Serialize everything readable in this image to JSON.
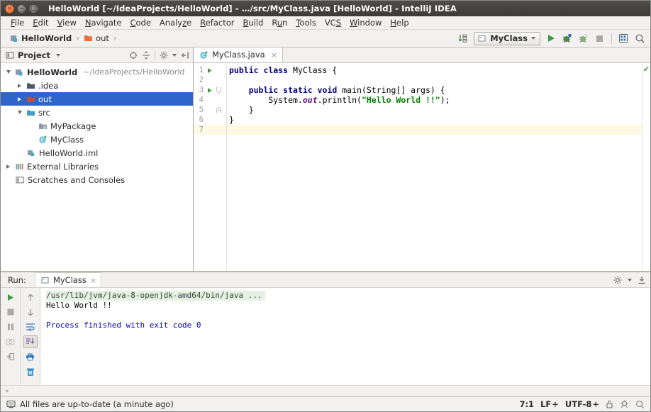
{
  "window": {
    "title": "HelloWorld [~/IdeaProjects/HelloWorld] - …/src/MyClass.java [HelloWorld] - IntelliJ IDEA",
    "close_glyph": "×",
    "min_glyph": "−",
    "max_glyph": "□",
    "accent": "#2f65ca"
  },
  "menubar": {
    "items": [
      {
        "pre": "",
        "mn": "F",
        "post": "ile"
      },
      {
        "pre": "",
        "mn": "E",
        "post": "dit"
      },
      {
        "pre": "",
        "mn": "V",
        "post": "iew"
      },
      {
        "pre": "",
        "mn": "N",
        "post": "avigate"
      },
      {
        "pre": "",
        "mn": "C",
        "post": "ode"
      },
      {
        "pre": "Analy",
        "mn": "z",
        "post": "e"
      },
      {
        "pre": "",
        "mn": "R",
        "post": "efactor"
      },
      {
        "pre": "",
        "mn": "B",
        "post": "uild"
      },
      {
        "pre": "R",
        "mn": "u",
        "post": "n"
      },
      {
        "pre": "",
        "mn": "T",
        "post": "ools"
      },
      {
        "pre": "VC",
        "mn": "S",
        "post": ""
      },
      {
        "pre": "",
        "mn": "W",
        "post": "indow"
      },
      {
        "pre": "",
        "mn": "H",
        "post": "elp"
      }
    ]
  },
  "navbar": {
    "breadcrumbs": [
      {
        "label": "HelloWorld",
        "icon": "module-icon",
        "bold": true
      },
      {
        "label": "out",
        "icon": "folder-icon",
        "bold": false
      }
    ],
    "separator": "›",
    "run_config": {
      "label": "MyClass",
      "icon": "class-config-icon"
    },
    "buttons": [
      {
        "name": "run-button",
        "title": "Run"
      },
      {
        "name": "debug-button",
        "title": "Debug"
      },
      {
        "name": "run-with-coverage-button",
        "title": "Run with Coverage"
      },
      {
        "name": "stop-button",
        "title": "Stop"
      },
      {
        "name": "select-target-button",
        "title": "Select Run/Debug Target"
      },
      {
        "name": "search-everywhere-button",
        "title": "Search Everywhere"
      }
    ],
    "sort_icon": "sort-alphabetically-icon"
  },
  "project_panel": {
    "title": "Project",
    "dropdown_glyph": "▾",
    "tools": [
      {
        "name": "locate-file-icon"
      },
      {
        "name": "collapse-all-icon"
      },
      {
        "name": "settings-gear-icon"
      },
      {
        "name": "hide-panel-icon"
      }
    ],
    "tree": [
      {
        "depth": 0,
        "toggle": "down",
        "icon": "module-icon",
        "label": "HelloWorld",
        "bold": true,
        "path": "~/IdeaProjects/HelloWorld",
        "selected": false
      },
      {
        "depth": 1,
        "toggle": "right",
        "icon": "folder-dark-icon",
        "label": ".idea",
        "bold": false,
        "path": "",
        "selected": false
      },
      {
        "depth": 1,
        "toggle": "right",
        "icon": "folder-out-icon",
        "label": "out",
        "bold": false,
        "path": "",
        "selected": true
      },
      {
        "depth": 1,
        "toggle": "down",
        "icon": "folder-src-icon",
        "label": "src",
        "bold": false,
        "path": "",
        "selected": false
      },
      {
        "depth": 2,
        "toggle": "none",
        "icon": "package-icon",
        "label": "MyPackage",
        "bold": false,
        "path": "",
        "selected": false
      },
      {
        "depth": 2,
        "toggle": "none",
        "icon": "class-icon",
        "label": "MyClass",
        "bold": false,
        "path": "",
        "selected": false
      },
      {
        "depth": 1,
        "toggle": "none",
        "icon": "iml-file-icon",
        "label": "HelloWorld.iml",
        "bold": false,
        "path": "",
        "selected": false
      },
      {
        "depth": 0,
        "toggle": "right",
        "icon": "libraries-icon",
        "label": "External Libraries",
        "bold": false,
        "path": "",
        "selected": false
      },
      {
        "depth": 0,
        "toggle": "none",
        "icon": "scratches-icon",
        "label": "Scratches and Consoles",
        "bold": false,
        "path": "",
        "selected": false
      }
    ]
  },
  "editor": {
    "tab": {
      "label": "MyClass.java",
      "icon": "java-class-icon",
      "close_glyph": "×"
    },
    "inspection_status": "✔",
    "lines": [
      {
        "num": "1",
        "run_marker": true,
        "fold": "none",
        "current": false
      },
      {
        "num": "2",
        "run_marker": false,
        "fold": "none",
        "current": false
      },
      {
        "num": "3",
        "run_marker": true,
        "fold": "open",
        "current": false
      },
      {
        "num": "4",
        "run_marker": false,
        "fold": "none",
        "current": false
      },
      {
        "num": "5",
        "run_marker": false,
        "fold": "close",
        "current": false
      },
      {
        "num": "6",
        "run_marker": false,
        "fold": "none",
        "current": false
      },
      {
        "num": "7",
        "run_marker": false,
        "fold": "none",
        "current": true
      }
    ],
    "code": [
      "public class MyClass {",
      "",
      "    public static void main(String[] args) {",
      "        System.out.println(\"Hello World !!\");",
      "    }",
      "}",
      ""
    ]
  },
  "run_panel": {
    "label": "Run:",
    "tab": {
      "label": "MyClass",
      "icon": "run-config-icon",
      "close_glyph": "×"
    },
    "header_tools": [
      {
        "name": "settings-gear-icon"
      },
      {
        "name": "hide-panel-icon"
      }
    ],
    "left_tools": [
      {
        "name": "rerun-button"
      },
      {
        "name": "stop-button"
      },
      {
        "name": "pause-output-button"
      },
      {
        "name": "dump-threads-button"
      },
      {
        "name": "exit-button"
      }
    ],
    "right_tools": [
      {
        "name": "up-arrow-button"
      },
      {
        "name": "down-arrow-button"
      },
      {
        "name": "soft-wrap-button"
      },
      {
        "name": "scroll-to-end-button"
      },
      {
        "name": "print-button"
      },
      {
        "name": "clear-all-button"
      }
    ],
    "console": [
      {
        "text": "/usr/lib/jvm/java-8-openjdk-amd64/bin/java ...",
        "style": "cmd"
      },
      {
        "text": "Hello World !!",
        "style": "out"
      },
      {
        "text": "",
        "style": "out"
      },
      {
        "text": "Process finished with exit code 0",
        "style": "fin"
      }
    ]
  },
  "bottom_strip": {
    "expand_glyph": "»",
    "toggle_icon": "terminal-toggle-icon"
  },
  "statusbar": {
    "icon": "save-status-icon",
    "message": "All files are up-to-date (a minute ago)",
    "caret": "7:1",
    "line_sep": "LF",
    "encoding": "UTF-8",
    "sep_glyph": "÷",
    "lock_icon": "lock-icon",
    "inspector_icon": "inspections-icon",
    "search_icon": "search-icon"
  }
}
